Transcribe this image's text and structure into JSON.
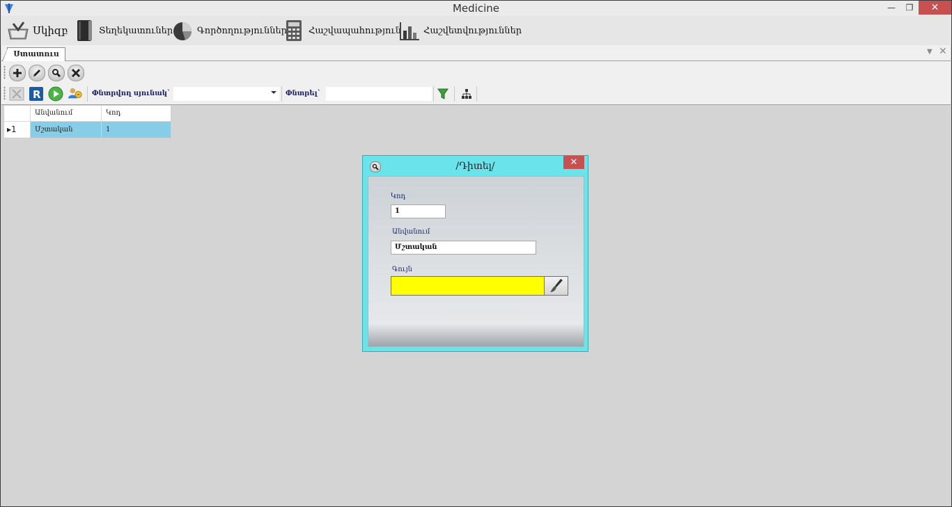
{
  "window": {
    "title": "Medicine",
    "minimize": "—",
    "restore": "❐",
    "close": "✕"
  },
  "menu": {
    "items": [
      {
        "label": "Սկիզբ"
      },
      {
        "label": "Տեղեկատուներ"
      },
      {
        "label": "Գործողություններ"
      },
      {
        "label": "Հաշվապահություն"
      },
      {
        "label": "Հաշվետվություններ"
      }
    ]
  },
  "tabs": {
    "active_label": "Ստատուս",
    "dropdown": "▼",
    "close": "✕"
  },
  "toolbar2": {
    "search_column_label": "Փնտրվող սյունակ`",
    "search_column_value": "",
    "search_label": "Փնտրել`",
    "search_value": ""
  },
  "grid": {
    "columns": [
      "Անվանում",
      "Կոդ"
    ],
    "rows": [
      {
        "marker": "▸1",
        "name": "Մշտական",
        "code": "1"
      }
    ]
  },
  "dialog": {
    "title": "/Դիտել/",
    "close": "✕",
    "code_label": "Կոդ",
    "code_value": "1",
    "name_label": "Անվանում",
    "name_value": "Մշտական",
    "color_label": "Գույն",
    "color_value": "#ffff00"
  },
  "colors": {
    "accent_dialog": "#6be3ea",
    "selection": "#87cde8",
    "close": "#c75050"
  }
}
